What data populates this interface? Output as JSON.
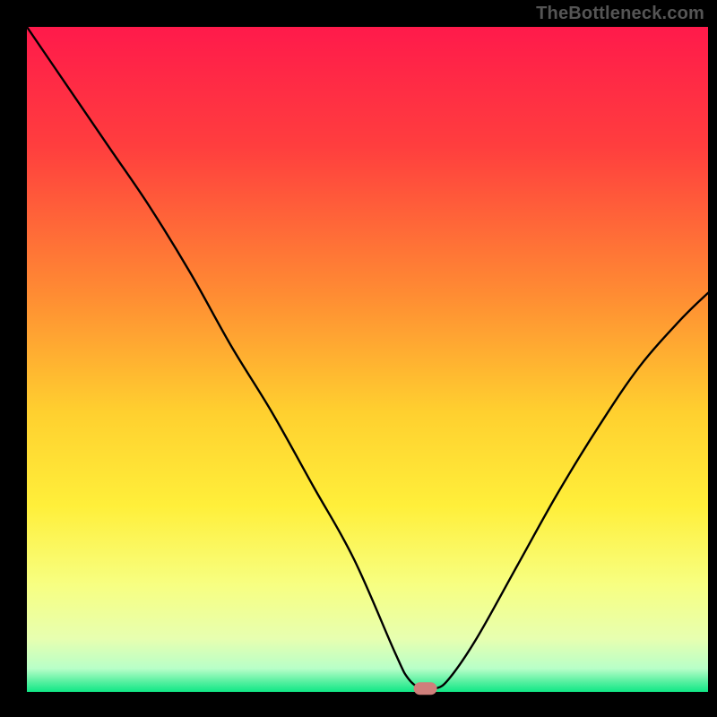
{
  "watermark": "TheBottleneck.com",
  "chart_data": {
    "type": "line",
    "title": "",
    "xlabel": "",
    "ylabel": "",
    "xlim": [
      0,
      100
    ],
    "ylim": [
      0,
      100
    ],
    "marker": {
      "x": 58.5,
      "y": 0.5,
      "color": "#cf7f7b"
    },
    "series": [
      {
        "name": "curve",
        "x": [
          0,
          6,
          12,
          18,
          24,
          30,
          36,
          42,
          48,
          54,
          56,
          58,
          60,
          62,
          66,
          72,
          78,
          84,
          90,
          96,
          100
        ],
        "y": [
          100,
          91,
          82,
          73,
          63,
          52,
          42,
          31,
          20,
          6,
          2,
          0.5,
          0.5,
          2,
          8,
          19,
          30,
          40,
          49,
          56,
          60
        ]
      }
    ],
    "gradient_stops": [
      {
        "offset": 0.0,
        "color": "#ff1a4b"
      },
      {
        "offset": 0.18,
        "color": "#ff3e3e"
      },
      {
        "offset": 0.4,
        "color": "#ff8b33"
      },
      {
        "offset": 0.58,
        "color": "#ffd02f"
      },
      {
        "offset": 0.72,
        "color": "#ffef3a"
      },
      {
        "offset": 0.84,
        "color": "#f7ff82"
      },
      {
        "offset": 0.92,
        "color": "#e7ffb0"
      },
      {
        "offset": 0.965,
        "color": "#b8ffc8"
      },
      {
        "offset": 0.985,
        "color": "#55f0a0"
      },
      {
        "offset": 1.0,
        "color": "#10e785"
      }
    ]
  }
}
